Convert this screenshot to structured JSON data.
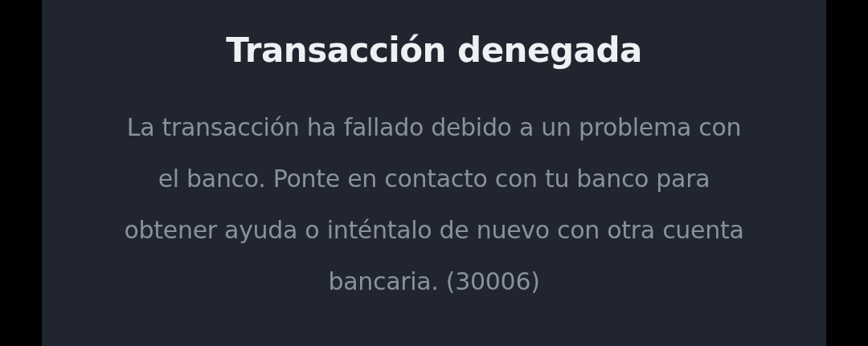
{
  "dialog": {
    "title": "Transacción denegada",
    "message_lines": [
      "La transacción ha fallado debido a un problema con",
      "el banco. Ponte en contacto con tu banco para",
      "obtener ayuda o inténtalo de nuevo con otra cuenta",
      "bancaria. (30006)"
    ]
  }
}
